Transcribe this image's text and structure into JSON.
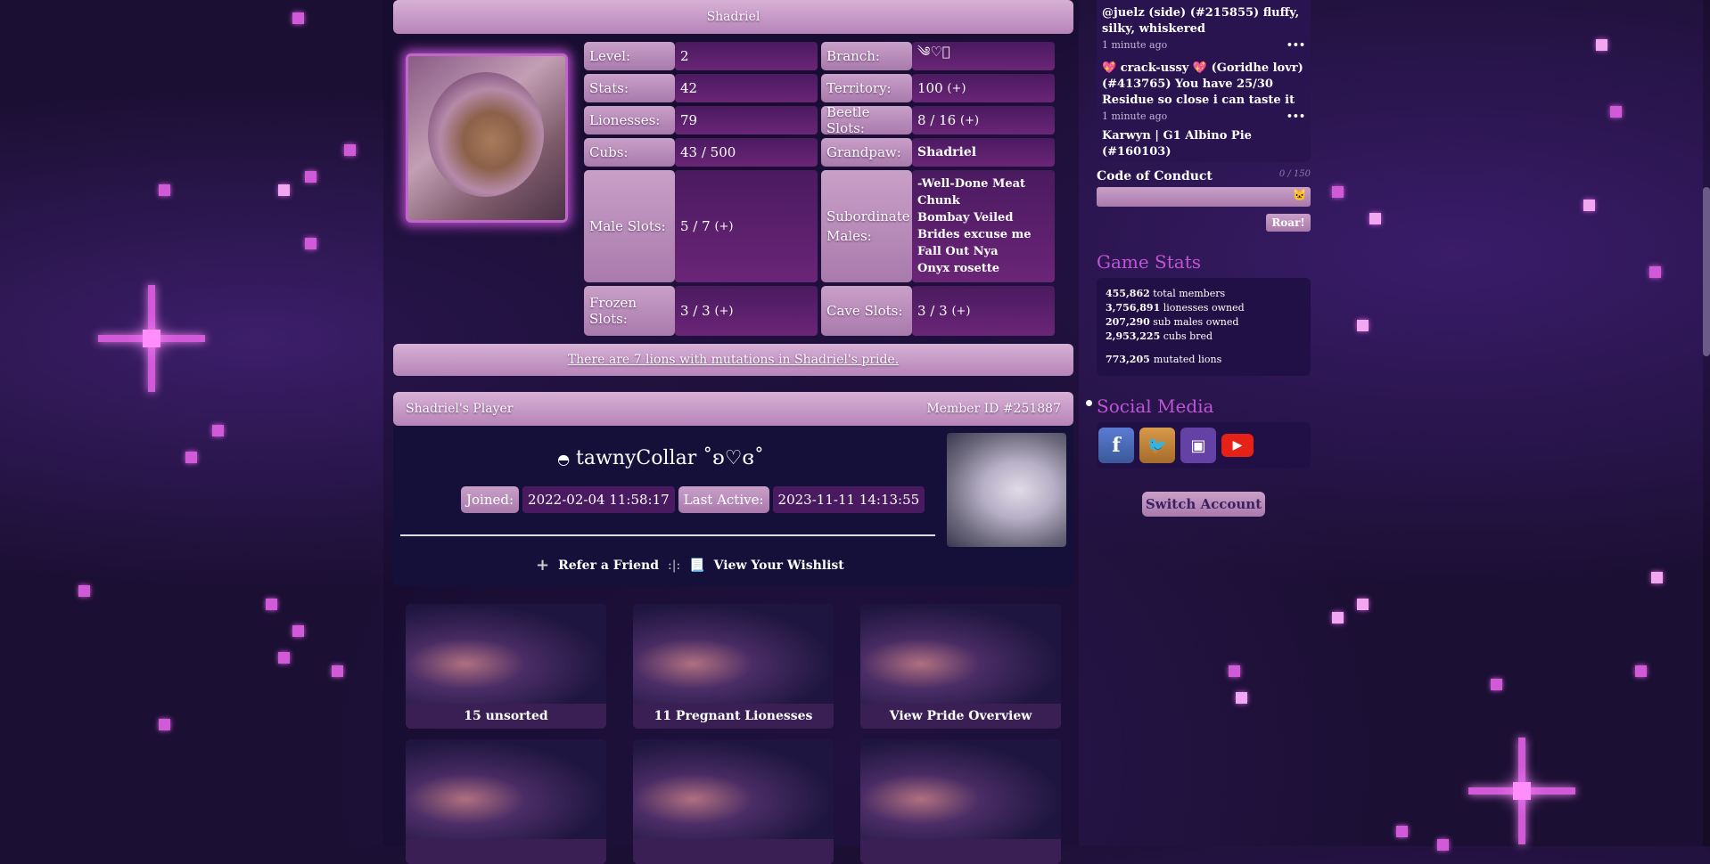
{
  "pride_title": "Shadriel",
  "stats": {
    "level_label": "Level:",
    "level": "2",
    "branch_label": "Branch:",
    "branch": "༄♡༘",
    "stats_label": "Stats:",
    "stats": "42",
    "territory_label": "Territory:",
    "territory": "100",
    "lionesses_label": "Lionesses:",
    "lionesses": "79",
    "beetle_label": "Beetle Slots:",
    "beetle": "8 / 16",
    "cubs_label": "Cubs:",
    "cubs": "43 / 500",
    "grandpaw_label": "Grandpaw:",
    "grandpaw": "Shadriel",
    "male_label": "Male Slots:",
    "male": "5 / 7",
    "sub_label": "Subordinate Males:",
    "subordinates": [
      "-Well-Done Meat Chunk",
      "Bombay Veiled Brides excuse me",
      "Fall Out Nya",
      "Onyx rosette"
    ],
    "frozen_label": "Frozen Slots:",
    "frozen": "3 / 3",
    "cave_label": "Cave Slots:",
    "cave": "3 / 3",
    "plus": "(+)"
  },
  "mutations_text": "There are 7 lions with mutations in Shadriel's pride.",
  "player": {
    "header": "Shadriel's Player",
    "member_id": "Member ID #251887",
    "username": "tawnyCollar ˚ʚ♡ɞ˚",
    "joined_label": "Joined:",
    "joined": "2022-02-04 11:58:17",
    "last_active_label": "Last Active:",
    "last_active": "2023-11-11 14:13:55",
    "refer": "Refer a Friend",
    "divider": ":|:",
    "wishlist": "View Your Wishlist"
  },
  "tiles": [
    "15 unsorted",
    "11 Pregnant Lionesses",
    "View Pride Overview",
    "",
    "",
    ""
  ],
  "shoutbox": {
    "messages": [
      {
        "text": "@juelz (side) (#215855) fluffy, silky, whiskered",
        "time": "1 minute ago"
      },
      {
        "text": "💖 crack-ussy 💖 (Goridhe lovr) (#413765) You have 25/30 Residue so close i can taste it",
        "time": "1 minute ago"
      },
      {
        "text": "Karwyn | G1 Albino Pie (#160103)",
        "time": ""
      }
    ],
    "coc": "Code of Conduct",
    "count": "0 / 150",
    "roar": "Roar!"
  },
  "game_stats": {
    "heading": "Game Stats",
    "rows": [
      {
        "num": "455,862",
        "label": "total members"
      },
      {
        "num": "3,756,891",
        "label": "lionesses owned"
      },
      {
        "num": "207,290",
        "label": "sub males owned"
      },
      {
        "num": "2,953,225",
        "label": "cubs bred"
      }
    ],
    "mutated_num": "773,205",
    "mutated_label": "mutated lions"
  },
  "social": {
    "heading": "Social Media",
    "icons": [
      "facebook-icon",
      "twitter-icon",
      "twitch-icon",
      "youtube-icon"
    ]
  },
  "switch_account": "Switch Account",
  "colors": {
    "accent": "#c054d6",
    "label_bg": "#c9a0c8",
    "value_bg": "#4a1a60"
  }
}
